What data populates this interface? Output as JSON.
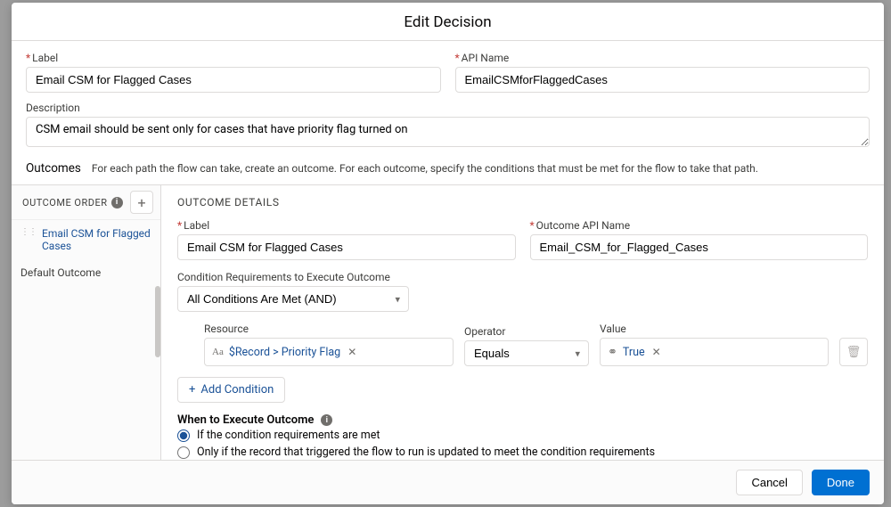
{
  "modal": {
    "title": "Edit Decision",
    "labels": {
      "label": "Label",
      "api_name": "API Name",
      "description": "Description"
    },
    "values": {
      "label": "Email CSM for Flagged Cases",
      "api_name": "EmailCSMforFlaggedCases",
      "description": "CSM email should be sent only for cases that have priority flag turned on"
    }
  },
  "outcomes": {
    "title": "Outcomes",
    "help": "For each path the flow can take, create an outcome. For each outcome, specify the conditions that must be met for the flow to take that path."
  },
  "sidebar": {
    "header": "OUTCOME ORDER",
    "items": [
      {
        "label": "Email CSM for Flagged Cases",
        "active": true
      },
      {
        "label": "Default Outcome",
        "active": false
      }
    ],
    "add_label": "+"
  },
  "details": {
    "title": "OUTCOME DETAILS",
    "labels": {
      "label": "Label",
      "api_name": "Outcome API Name",
      "cond_req": "Condition Requirements to Execute Outcome",
      "resource": "Resource",
      "operator": "Operator",
      "value": "Value",
      "add_condition": "Add Condition",
      "execute_title": "When to Execute Outcome"
    },
    "values": {
      "label": "Email CSM for Flagged Cases",
      "api_name": "Email_CSM_for_Flagged_Cases",
      "cond_req": "All Conditions Are Met (AND)",
      "resource": "$Record > Priority Flag",
      "operator": "Equals",
      "value": "True"
    },
    "radios": {
      "opt1": "If the condition requirements are met",
      "opt2": "Only if the record that triggered the flow to run is updated to meet the condition requirements"
    }
  },
  "footer": {
    "cancel": "Cancel",
    "done": "Done"
  }
}
